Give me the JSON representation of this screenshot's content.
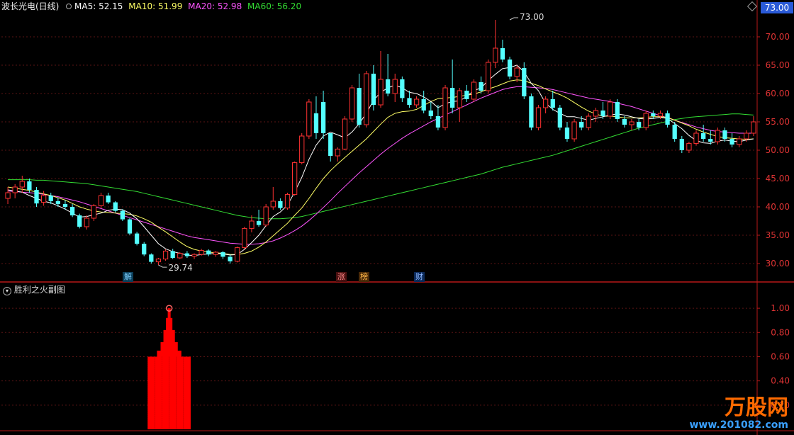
{
  "header": {
    "stock_name": "波长光电(日线)",
    "ma5": "MA5: 52.15",
    "ma10": "MA10: 51.99",
    "ma20": "MA20: 52.98",
    "ma60": "MA60: 56.20",
    "current_price": "73.00"
  },
  "sub_panel": {
    "title": "胜利之火副图"
  },
  "watermark": {
    "title": "万股网",
    "url": "www.201082.com"
  },
  "markers": {
    "jie": "解",
    "zhang": "涨",
    "bang": "榜",
    "cai": "财"
  },
  "colors": {
    "background": "#000000",
    "up": "#ff3232",
    "down": "#54ffff",
    "ma5": "#ffffff",
    "ma10": "#ffff66",
    "ma20": "#ff55ff",
    "ma60": "#33dd33",
    "axis": "#b81818",
    "indicator": "#ff0000"
  },
  "chart_data": [
    {
      "type": "candlestick",
      "title": "波长光电(日线)",
      "ylim": [
        27,
        74
      ],
      "y_ticks": [
        30.0,
        35.0,
        40.0,
        45.0,
        50.0,
        55.0,
        60.0,
        65.0,
        70.0
      ],
      "annotations": [
        {
          "text": "73.00",
          "index": 70,
          "price": 73.0,
          "kind": "high"
        },
        {
          "text": "29.74",
          "index": 21,
          "price": 29.74,
          "kind": "low"
        }
      ],
      "ohlc": [
        [
          41.5,
          43.5,
          40.5,
          42.5
        ],
        [
          42.5,
          44.0,
          41.5,
          43.5
        ],
        [
          43.5,
          45.5,
          42.5,
          44.5
        ],
        [
          44.5,
          45.0,
          42.5,
          43.0
        ],
        [
          43.0,
          43.5,
          40.0,
          40.6
        ],
        [
          40.8,
          42.8,
          40.2,
          42.0
        ],
        [
          42.0,
          42.5,
          40.5,
          41.0
        ],
        [
          41.0,
          41.6,
          40.0,
          40.5
        ],
        [
          40.5,
          41.2,
          39.5,
          40.0
        ],
        [
          40.0,
          40.5,
          38.2,
          38.5
        ],
        [
          38.5,
          38.8,
          36.2,
          36.5
        ],
        [
          36.5,
          38.5,
          36.0,
          38.0
        ],
        [
          38.0,
          40.5,
          37.5,
          40.2
        ],
        [
          40.2,
          42.5,
          39.8,
          42.0
        ],
        [
          42.0,
          42.5,
          40.5,
          40.8
        ],
        [
          40.8,
          41.0,
          39.0,
          39.3
        ],
        [
          39.3,
          39.6,
          37.5,
          37.8
        ],
        [
          37.8,
          38.0,
          35.0,
          35.3
        ],
        [
          35.3,
          35.6,
          33.2,
          33.5
        ],
        [
          33.5,
          33.8,
          31.3,
          31.6
        ],
        [
          31.6,
          31.8,
          30.0,
          30.3
        ],
        [
          30.3,
          31.0,
          29.74,
          30.8
        ],
        [
          30.8,
          32.5,
          30.5,
          32.2
        ],
        [
          32.2,
          32.6,
          30.8,
          31.0
        ],
        [
          31.0,
          32.0,
          30.8,
          31.8
        ],
        [
          31.8,
          32.2,
          31.0,
          31.3
        ],
        [
          31.3,
          31.8,
          30.8,
          31.6
        ],
        [
          31.6,
          32.6,
          31.4,
          32.3
        ],
        [
          32.3,
          32.5,
          31.3,
          31.6
        ],
        [
          31.6,
          32.2,
          31.2,
          32.0
        ],
        [
          32.0,
          32.2,
          30.8,
          31.2
        ],
        [
          31.2,
          31.6,
          30.0,
          30.4
        ],
        [
          30.4,
          33.0,
          30.2,
          32.8
        ],
        [
          32.8,
          36.5,
          32.5,
          36.2
        ],
        [
          36.2,
          38.5,
          35.5,
          37.5
        ],
        [
          37.5,
          39.5,
          36.5,
          36.8
        ],
        [
          36.8,
          40.5,
          36.5,
          40.0
        ],
        [
          40.0,
          43.5,
          39.5,
          41.0
        ],
        [
          41.0,
          41.5,
          39.5,
          39.8
        ],
        [
          39.8,
          42.5,
          39.5,
          42.2
        ],
        [
          42.2,
          48.0,
          42.0,
          47.8
        ],
        [
          47.8,
          53.0,
          47.5,
          52.5
        ],
        [
          52.5,
          59.0,
          52.0,
          58.5
        ],
        [
          56.5,
          59.5,
          52.0,
          53.0
        ],
        [
          58.5,
          60.5,
          52.0,
          53.0
        ],
        [
          53.0,
          51.0,
          48.0,
          49.0
        ],
        [
          49.0,
          50.5,
          48.0,
          50.2
        ],
        [
          50.2,
          56.0,
          50.0,
          55.5
        ],
        [
          55.5,
          61.5,
          55.0,
          61.0
        ],
        [
          61.0,
          63.5,
          54.0,
          54.5
        ],
        [
          54.5,
          64.0,
          54.0,
          63.5
        ],
        [
          63.5,
          65.0,
          57.0,
          58.0
        ],
        [
          58.0,
          67.5,
          57.5,
          62.5
        ],
        [
          62.5,
          67.0,
          59.5,
          60.0
        ],
        [
          60.0,
          63.5,
          58.5,
          62.5
        ],
        [
          62.5,
          63.0,
          58.5,
          59.2
        ],
        [
          59.2,
          60.5,
          57.5,
          58.0
        ],
        [
          58.0,
          59.5,
          57.5,
          59.0
        ],
        [
          59.0,
          60.5,
          56.5,
          57.0
        ],
        [
          57.0,
          58.5,
          55.5,
          56.0
        ],
        [
          56.0,
          58.0,
          53.5,
          54.0
        ],
        [
          54.0,
          61.5,
          53.5,
          61.0
        ],
        [
          61.0,
          66.0,
          56.5,
          57.5
        ],
        [
          57.5,
          61.0,
          55.0,
          60.5
        ],
        [
          60.5,
          61.5,
          58.5,
          59.0
        ],
        [
          59.0,
          62.5,
          58.5,
          62.0
        ],
        [
          62.0,
          63.0,
          60.0,
          60.5
        ],
        [
          60.5,
          66.0,
          60.0,
          65.5
        ],
        [
          65.5,
          73.0,
          64.5,
          68.0
        ],
        [
          68.0,
          69.5,
          65.5,
          66.0
        ],
        [
          66.0,
          66.5,
          62.5,
          63.0
        ],
        [
          63.0,
          65.0,
          62.0,
          64.5
        ],
        [
          64.5,
          65.5,
          59.0,
          59.5
        ],
        [
          59.5,
          60.0,
          53.5,
          54.0
        ],
        [
          54.0,
          58.0,
          53.5,
          57.5
        ],
        [
          57.5,
          59.5,
          56.5,
          59.0
        ],
        [
          59.0,
          60.5,
          57.0,
          57.5
        ],
        [
          57.5,
          58.0,
          53.5,
          54.0
        ],
        [
          54.0,
          55.0,
          51.5,
          52.0
        ],
        [
          52.0,
          55.5,
          51.5,
          55.0
        ],
        [
          55.0,
          56.0,
          53.5,
          54.0
        ],
        [
          54.0,
          56.5,
          53.5,
          56.0
        ],
        [
          56.0,
          57.5,
          55.0,
          57.0
        ],
        [
          57.0,
          58.5,
          55.5,
          56.0
        ],
        [
          56.0,
          59.0,
          55.5,
          58.5
        ],
        [
          58.5,
          59.0,
          55.0,
          55.5
        ],
        [
          55.5,
          56.0,
          54.0,
          54.5
        ],
        [
          54.5,
          55.5,
          53.5,
          55.0
        ],
        [
          55.0,
          55.5,
          53.5,
          54.0
        ],
        [
          54.0,
          57.0,
          53.5,
          56.5
        ],
        [
          56.5,
          57.0,
          55.5,
          56.0
        ],
        [
          56.0,
          57.0,
          55.5,
          56.5
        ],
        [
          56.5,
          57.0,
          54.0,
          54.5
        ],
        [
          54.5,
          55.0,
          51.5,
          52.0
        ],
        [
          52.0,
          52.5,
          49.5,
          50.0
        ],
        [
          50.0,
          51.5,
          49.5,
          51.2
        ],
        [
          51.2,
          53.5,
          50.8,
          53.0
        ],
        [
          53.0,
          54.5,
          51.5,
          52.0
        ],
        [
          52.0,
          53.5,
          51.0,
          51.5
        ],
        [
          51.5,
          54.0,
          51.0,
          53.5
        ],
        [
          53.5,
          54.0,
          51.5,
          52.0
        ],
        [
          52.0,
          53.0,
          50.5,
          51.0
        ],
        [
          51.0,
          52.5,
          50.5,
          52.0
        ],
        [
          52.0,
          53.5,
          51.5,
          53.0
        ],
        [
          53.0,
          56.0,
          52.5,
          55.0
        ]
      ],
      "ma5": [
        43.0,
        42.8,
        42.6,
        42.0,
        41.5,
        41.0,
        40.7,
        40.2,
        39.6,
        38.9,
        38.2,
        38.3,
        38.6,
        38.9,
        39.4,
        39.6,
        39.5,
        38.9,
        37.9,
        36.5,
        35.0,
        33.5,
        32.6,
        32.1,
        31.8,
        31.5,
        31.4,
        31.6,
        31.7,
        31.8,
        31.7,
        31.5,
        31.6,
        32.5,
        33.7,
        35.0,
        36.7,
        38.3,
        39.1,
        40.3,
        42.6,
        45.2,
        48.4,
        50.9,
        52.5,
        53.2,
        52.7,
        52.2,
        53.2,
        54.7,
        56.5,
        58.8,
        60.2,
        61.0,
        61.5,
        61.0,
        60.2,
        60.0,
        59.4,
        58.6,
        57.5,
        58.2,
        58.6,
        58.7,
        59.5,
        60.5,
        61.0,
        62.3,
        63.4,
        64.4,
        64.6,
        65.0,
        63.8,
        61.8,
        60.5,
        58.3,
        57.2,
        56.5,
        55.9,
        55.9,
        55.6,
        55.3,
        55.6,
        55.9,
        56.2,
        56.4,
        56.2,
        55.9,
        55.6,
        55.5,
        55.6,
        55.8,
        55.6,
        54.7,
        53.8,
        52.6,
        51.7,
        51.3,
        51.2,
        51.6,
        51.8,
        51.6,
        51.5,
        51.8,
        52.0
      ],
      "ma10": [
        43.5,
        43.3,
        43.1,
        42.9,
        42.6,
        42.3,
        42.0,
        41.6,
        41.2,
        40.6,
        40.0,
        39.6,
        39.3,
        39.1,
        39.0,
        38.9,
        38.8,
        38.7,
        38.4,
        37.9,
        37.3,
        36.4,
        35.6,
        34.7,
        33.8,
        33.0,
        32.5,
        32.2,
        32.0,
        31.9,
        31.8,
        31.6,
        31.6,
        31.8,
        32.2,
        32.9,
        33.8,
        34.9,
        36.0,
        37.1,
        38.5,
        39.8,
        41.5,
        43.3,
        45.0,
        46.4,
        47.6,
        48.7,
        49.8,
        50.9,
        52.0,
        53.3,
        54.6,
        55.8,
        56.5,
        56.8,
        56.9,
        57.2,
        57.9,
        58.6,
        59.1,
        59.2,
        59.3,
        59.5,
        59.7,
        59.9,
        60.3,
        60.8,
        61.2,
        61.7,
        62.2,
        62.4,
        62.3,
        61.8,
        61.4,
        60.8,
        60.3,
        59.8,
        59.2,
        58.4,
        57.6,
        56.9,
        56.4,
        56.0,
        56.0,
        55.9,
        55.7,
        55.7,
        55.7,
        55.8,
        55.9,
        55.9,
        55.8,
        55.3,
        54.8,
        54.3,
        53.7,
        53.2,
        52.8,
        52.4,
        52.2,
        52.1,
        52.0,
        51.9,
        52.0
      ],
      "ma20": [
        42.8,
        42.7,
        42.6,
        42.5,
        42.4,
        42.2,
        42.0,
        41.8,
        41.5,
        41.2,
        40.9,
        40.5,
        40.1,
        39.7,
        39.3,
        38.9,
        38.5,
        38.1,
        37.7,
        37.3,
        36.9,
        36.5,
        36.1,
        35.7,
        35.3,
        34.9,
        34.6,
        34.4,
        34.2,
        34.0,
        33.8,
        33.6,
        33.5,
        33.4,
        33.4,
        33.5,
        33.7,
        34.0,
        34.5,
        35.1,
        35.8,
        36.6,
        37.6,
        38.7,
        39.9,
        41.1,
        42.4,
        43.6,
        44.8,
        46.0,
        47.1,
        48.2,
        49.3,
        50.3,
        51.2,
        52.1,
        52.9,
        53.6,
        54.3,
        55.0,
        55.6,
        56.2,
        56.8,
        57.4,
        58.0,
        58.6,
        59.2,
        59.7,
        60.2,
        60.7,
        61.0,
        61.2,
        61.2,
        61.1,
        61.0,
        60.9,
        60.7,
        60.4,
        60.1,
        59.8,
        59.5,
        59.2,
        59.0,
        58.8,
        58.6,
        58.3,
        58.0,
        57.7,
        57.3,
        56.9,
        56.5,
        56.1,
        55.7,
        55.3,
        54.9,
        54.5,
        54.1,
        53.8,
        53.5,
        53.3,
        53.2,
        53.1,
        53.0,
        53.0,
        53.0
      ],
      "ma60": [
        44.8,
        44.8,
        44.8,
        44.8,
        44.7,
        44.7,
        44.6,
        44.5,
        44.4,
        44.3,
        44.2,
        44.1,
        43.9,
        43.7,
        43.5,
        43.3,
        43.1,
        42.9,
        42.7,
        42.4,
        42.1,
        41.8,
        41.5,
        41.2,
        40.9,
        40.6,
        40.3,
        40.0,
        39.7,
        39.4,
        39.1,
        38.8,
        38.5,
        38.3,
        38.1,
        38.0,
        37.9,
        37.9,
        37.9,
        38.0,
        38.1,
        38.3,
        38.6,
        38.9,
        39.2,
        39.5,
        39.8,
        40.1,
        40.4,
        40.7,
        41.0,
        41.3,
        41.6,
        41.9,
        42.2,
        42.5,
        42.8,
        43.1,
        43.4,
        43.7,
        44.0,
        44.3,
        44.6,
        44.9,
        45.2,
        45.5,
        45.8,
        46.2,
        46.6,
        47.0,
        47.3,
        47.6,
        47.9,
        48.2,
        48.5,
        48.8,
        49.1,
        49.5,
        49.9,
        50.3,
        50.7,
        51.1,
        51.5,
        51.9,
        52.3,
        52.7,
        53.1,
        53.5,
        53.9,
        54.2,
        54.5,
        54.8,
        55.1,
        55.4,
        55.6,
        55.8,
        55.9,
        56.0,
        56.1,
        56.2,
        56.3,
        56.4,
        56.4,
        56.3,
        56.2
      ]
    },
    {
      "type": "bar",
      "title": "胜利之火副图",
      "ylim": [
        0,
        1.1
      ],
      "y_ticks": [
        0.2,
        0.4,
        0.6,
        0.8,
        1.0
      ],
      "bars": [
        {
          "index": 20,
          "value": 0.6
        },
        {
          "index": 21,
          "value": 0.6
        },
        {
          "index": 22,
          "value": 0.6
        },
        {
          "index": 23,
          "value": 0.6
        },
        {
          "index": 24,
          "value": 0.6
        },
        {
          "index": 25,
          "value": 0.6
        }
      ],
      "spike": {
        "index": 22.5,
        "value": 1.0
      }
    }
  ]
}
